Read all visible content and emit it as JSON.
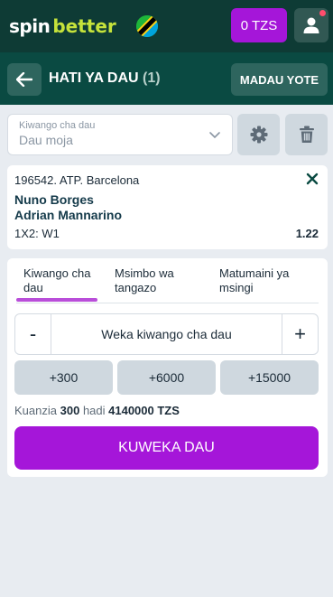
{
  "header": {
    "logo_part1": "spin",
    "logo_part2": "better",
    "balance": "0 TZS"
  },
  "subheader": {
    "title": "HATI YA DAU",
    "count": "(1)",
    "all_bets_label": "MADAU YOTE"
  },
  "stake_type": {
    "label": "Kiwango cha dau",
    "value": "Dau moja"
  },
  "bet": {
    "event": "196542. ATP. Barcelona",
    "team1": "Nuno Borges",
    "team2": "Adrian Mannarino",
    "market": "1X2: W1",
    "odds": "1.22"
  },
  "tabs": [
    {
      "line1": "Kiwango cha",
      "line2": "dau"
    },
    {
      "line1": "Msimbo wa",
      "line2": "tangazo"
    },
    {
      "line1": "Matumaini ya",
      "line2": "msingi"
    }
  ],
  "stepper": {
    "minus": "-",
    "plus": "+",
    "placeholder": "Weka kiwango cha dau"
  },
  "quick_amounts": [
    "+300",
    "+6000",
    "+15000"
  ],
  "range": {
    "prefix": "Kuanzia",
    "min": "300",
    "mid": "hadi",
    "max": "4140000 TZS"
  },
  "place_bet_label": "KUWEKA DAU",
  "colors": {
    "topbar": "#0e3b35",
    "subheader": "#0a4a42",
    "accent": "#a516d9",
    "logo_green": "#c6e33b"
  }
}
